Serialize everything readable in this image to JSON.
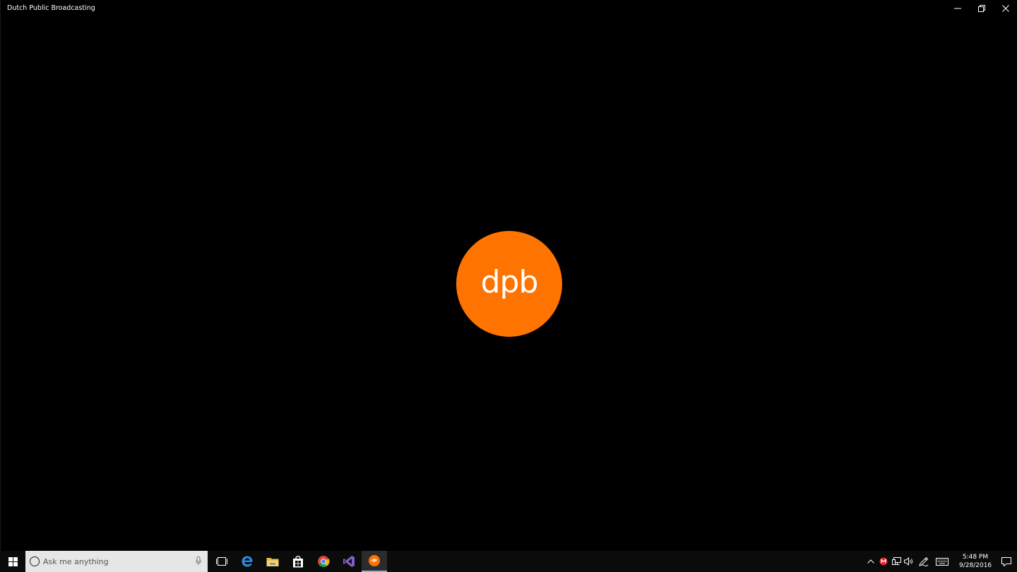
{
  "window": {
    "title": "Dutch Public Broadcasting",
    "controls": [
      "minimize-icon",
      "restore-icon",
      "close-icon"
    ]
  },
  "splash": {
    "logo_text": "dpb",
    "color": "#ff7300"
  },
  "taskbar": {
    "search_placeholder": "Ask me anything",
    "apps": [
      {
        "name": "task-view",
        "icon": "task-view-icon"
      },
      {
        "name": "edge",
        "icon": "edge-icon"
      },
      {
        "name": "file-explorer",
        "icon": "folder-icon"
      },
      {
        "name": "store",
        "icon": "store-icon"
      },
      {
        "name": "chrome",
        "icon": "chrome-icon"
      },
      {
        "name": "visual-studio",
        "icon": "visual-studio-icon"
      },
      {
        "name": "dpb",
        "icon": "dpb-icon",
        "active": true
      }
    ],
    "tray": {
      "time": "5:48 PM",
      "date": "9/28/2016"
    }
  },
  "colors": {
    "accent": "#ff7300",
    "taskbar": "#0b0b0b",
    "active_indicator": "#7db3e8"
  }
}
